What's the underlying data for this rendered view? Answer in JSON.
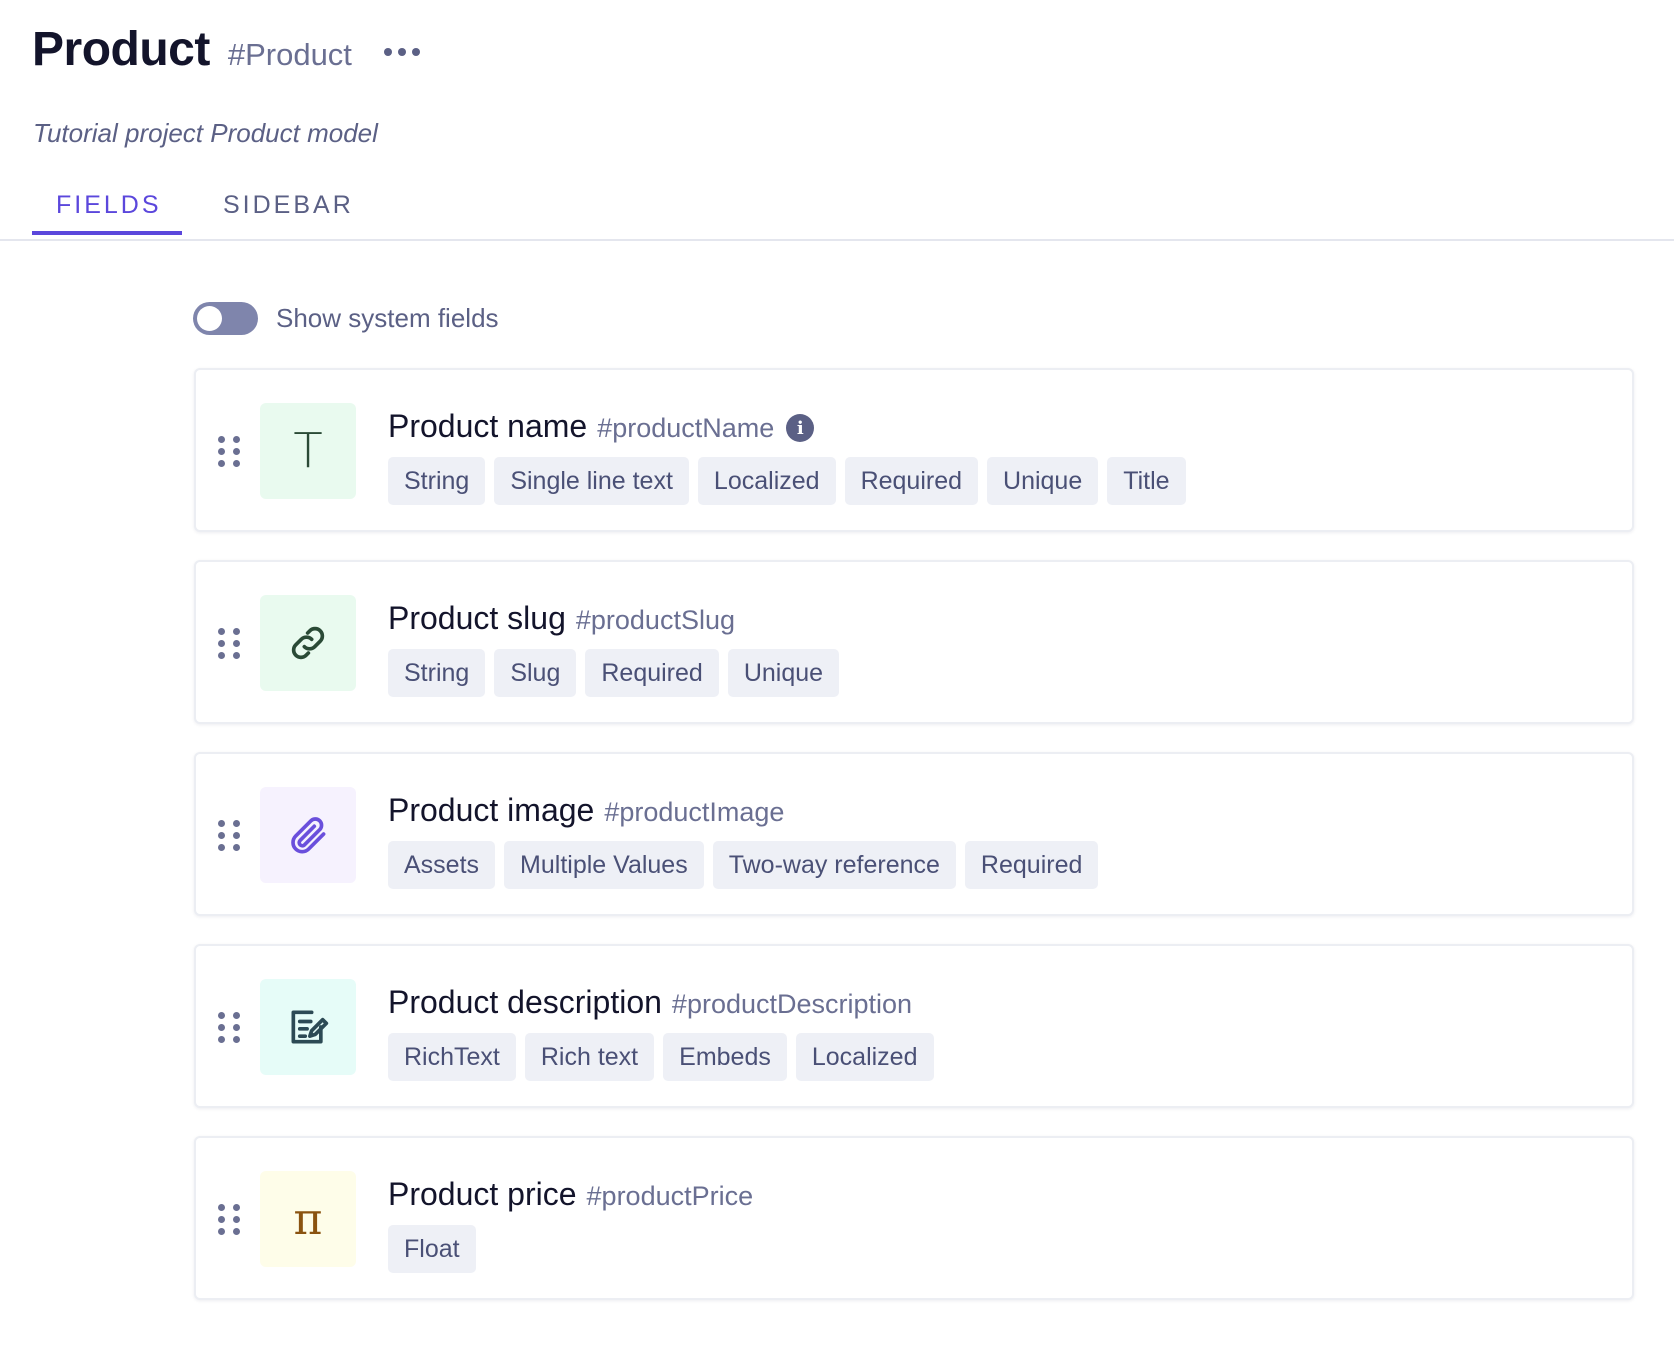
{
  "header": {
    "title": "Product",
    "api_id": "#Product",
    "description": "Tutorial project Product model"
  },
  "tabs": [
    {
      "label": "FIELDS",
      "active": true
    },
    {
      "label": "SIDEBAR",
      "active": false
    }
  ],
  "system_fields_toggle": {
    "label": "Show system fields",
    "on": false
  },
  "fields": [
    {
      "name": "Product name",
      "api_id": "#productName",
      "icon": "text-T-icon",
      "icon_bg": "#e9faef",
      "has_info": true,
      "tags": [
        "String",
        "Single line text",
        "Localized",
        "Required",
        "Unique",
        "Title"
      ]
    },
    {
      "name": "Product slug",
      "api_id": "#productSlug",
      "icon": "link-icon",
      "icon_bg": "#e9faef",
      "tags": [
        "String",
        "Slug",
        "Required",
        "Unique"
      ]
    },
    {
      "name": "Product image",
      "api_id": "#productImage",
      "icon": "paperclip-icon",
      "icon_bg": "#f6f2fe",
      "tags": [
        "Assets",
        "Multiple Values",
        "Two-way reference",
        "Required"
      ]
    },
    {
      "name": "Product description",
      "api_id": "#productDescription",
      "icon": "rich-text-edit-icon",
      "icon_bg": "#e6fcf8",
      "tags": [
        "RichText",
        "Rich text",
        "Embeds",
        "Localized"
      ]
    },
    {
      "name": "Product price",
      "api_id": "#productPrice",
      "icon": "pi-icon",
      "icon_bg": "#fefde9",
      "tags": [
        "Float"
      ]
    }
  ],
  "colors": {
    "accent": "#5b47dc",
    "text_muted": "#6a6f92",
    "tag_bg": "#eef0f6"
  }
}
